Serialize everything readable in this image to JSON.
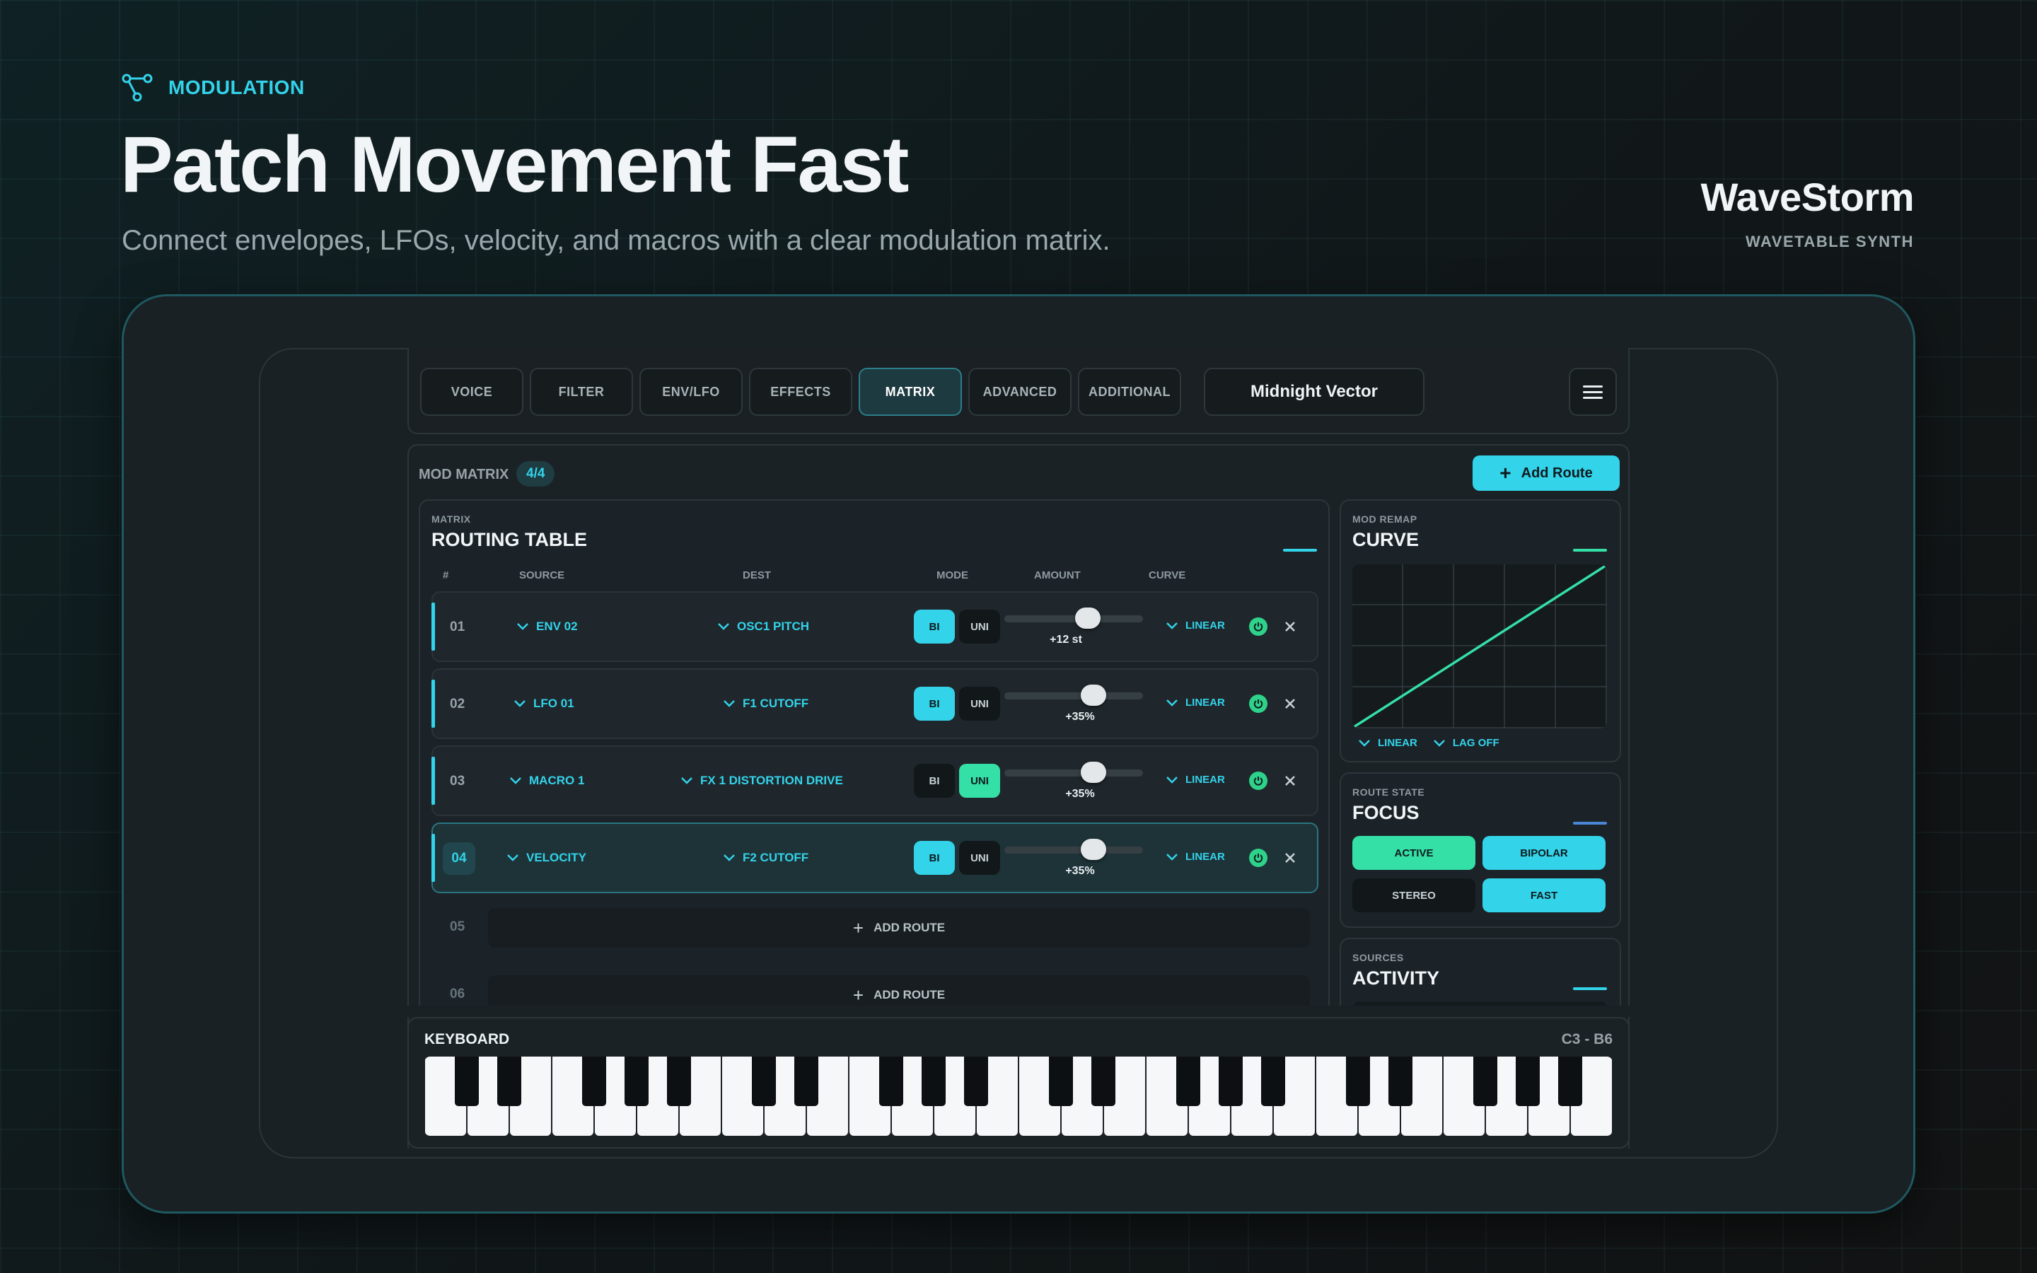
{
  "hero": {
    "eyebrow": "MODULATION",
    "title": "Patch Movement Fast",
    "subtitle": "Connect envelopes, LFOs, velocity, and macros with a clear modulation matrix."
  },
  "brand": {
    "name": "WaveStorm",
    "tagline": "WAVETABLE SYNTH"
  },
  "tabs": [
    {
      "label": "VOICE",
      "active": false
    },
    {
      "label": "FILTER",
      "active": false
    },
    {
      "label": "ENV/LFO",
      "active": false
    },
    {
      "label": "EFFECTS",
      "active": false
    },
    {
      "label": "MATRIX",
      "active": true
    },
    {
      "label": "ADVANCED",
      "active": false
    },
    {
      "label": "ADDITIONAL",
      "active": false
    }
  ],
  "preset": {
    "name": "Midnight Vector"
  },
  "menu_icon": "hamburger-menu-icon",
  "mod_matrix": {
    "label": "MOD MATRIX",
    "count": "4/4",
    "add_route_label": "Add Route"
  },
  "routing_table": {
    "eyebrow": "MATRIX",
    "title": "ROUTING TABLE",
    "columns": {
      "num": "#",
      "source": "SOURCE",
      "dest": "DEST",
      "mode": "MODE",
      "amount": "AMOUNT",
      "curve": "CURVE"
    },
    "mode_labels": {
      "bi": "BI",
      "uni": "UNI"
    },
    "rows": [
      {
        "num": "01",
        "source": "ENV 02",
        "dest": "OSC1 PITCH",
        "mode": "BI",
        "amount_label": "+12 st",
        "amount_fraction": 0.6,
        "curve": "LINEAR",
        "enabled": true,
        "focused": false
      },
      {
        "num": "02",
        "source": "LFO 01",
        "dest": "F1 CUTOFF",
        "mode": "BI",
        "amount_label": "+35%",
        "amount_fraction": 0.65,
        "curve": "LINEAR",
        "enabled": true,
        "focused": false
      },
      {
        "num": "03",
        "source": "MACRO 1",
        "dest": "FX 1 DISTORTION DRIVE",
        "mode": "UNI",
        "amount_label": "+35%",
        "amount_fraction": 0.65,
        "curve": "LINEAR",
        "enabled": true,
        "focused": false
      },
      {
        "num": "04",
        "source": "VELOCITY",
        "dest": "F2 CUTOFF",
        "mode": "BI",
        "amount_label": "+35%",
        "amount_fraction": 0.65,
        "curve": "LINEAR",
        "enabled": true,
        "focused": true
      }
    ],
    "empty_slots": [
      {
        "num": "05",
        "label": "ADD ROUTE"
      },
      {
        "num": "06",
        "label": "ADD ROUTE"
      }
    ]
  },
  "mod_remap": {
    "eyebrow": "MOD REMAP",
    "title": "CURVE",
    "curve_type": "LINEAR",
    "lag": "LAG OFF"
  },
  "route_state": {
    "eyebrow": "ROUTE STATE",
    "title": "FOCUS",
    "buttons": [
      {
        "label": "ACTIVE",
        "on": true
      },
      {
        "label": "BIPOLAR",
        "on": true
      },
      {
        "label": "STEREO",
        "on": false
      },
      {
        "label": "FAST",
        "on": true
      }
    ]
  },
  "sources": {
    "eyebrow": "SOURCES",
    "title": "ACTIVITY"
  },
  "keyboard": {
    "title": "KEYBOARD",
    "range": "C3 - B6",
    "octaves": 4
  },
  "colors": {
    "accent_cyan": "#33d3ea",
    "accent_green": "#34e0a6",
    "accent_blue": "#4a86d6",
    "panel": "#1c2328",
    "background": "#0f1a1c"
  }
}
